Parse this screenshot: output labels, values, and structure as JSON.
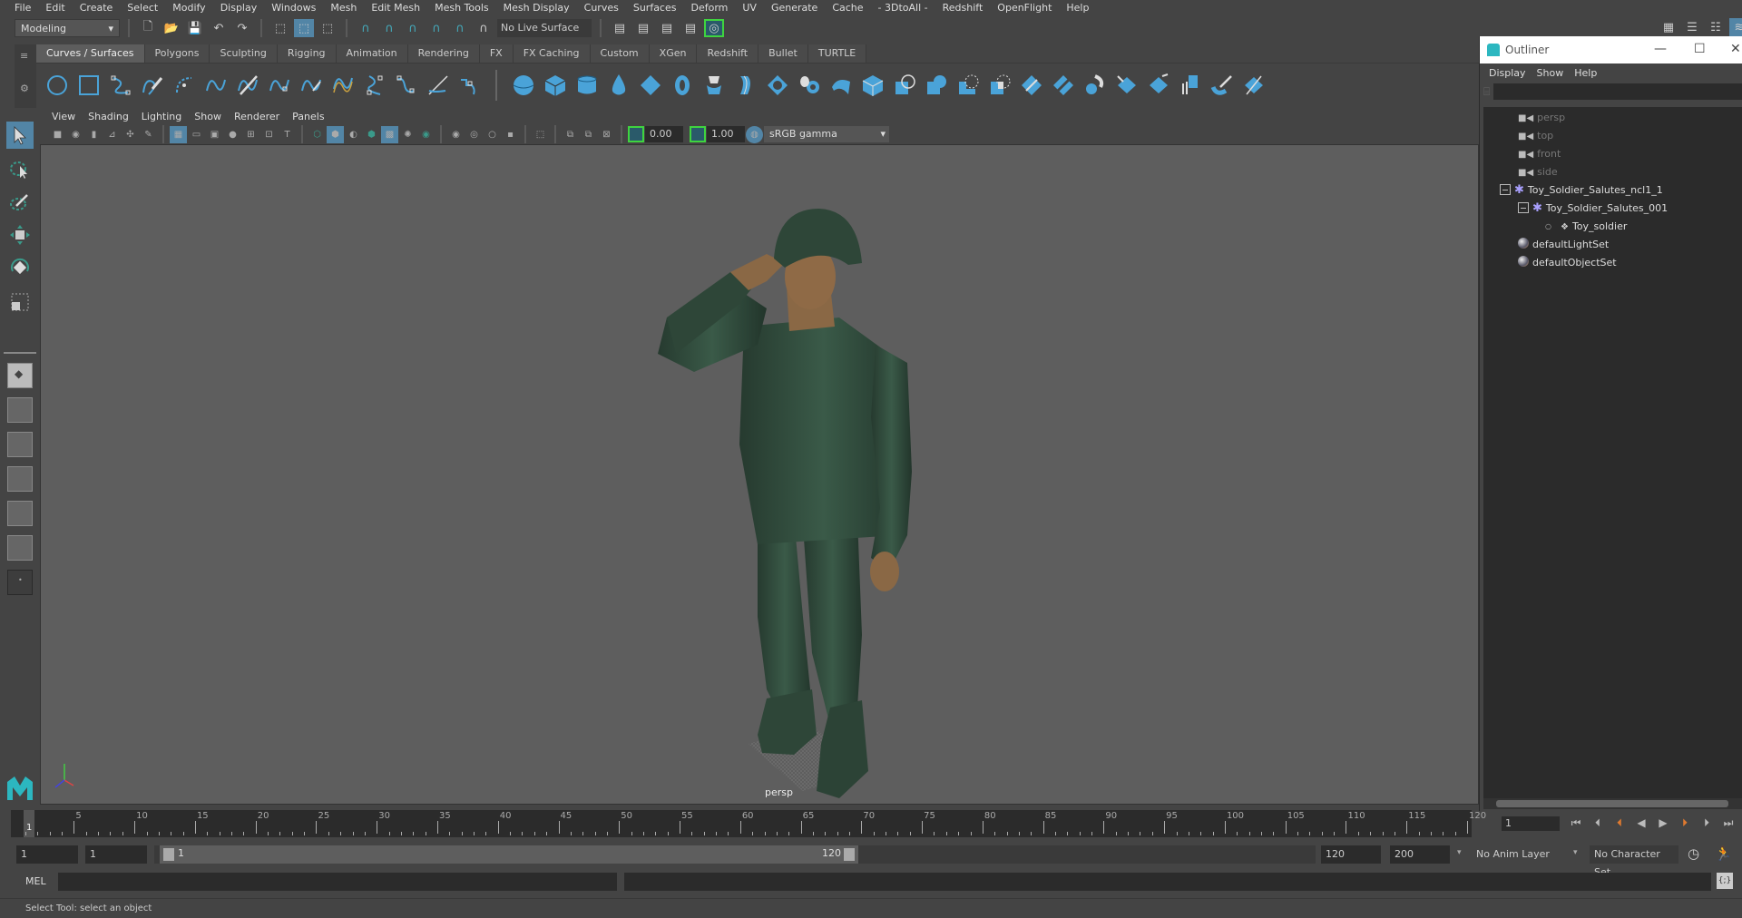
{
  "menubar": {
    "items": [
      "File",
      "Edit",
      "Create",
      "Select",
      "Modify",
      "Display",
      "Windows",
      "Mesh",
      "Edit Mesh",
      "Mesh Tools",
      "Mesh Display",
      "Curves",
      "Surfaces",
      "Deform",
      "UV",
      "Generate",
      "Cache",
      "- 3DtoAll -",
      "Redshift",
      "OpenFlight",
      "Help"
    ]
  },
  "statusline": {
    "mode": "Modeling",
    "live_surface": "No Live Surface"
  },
  "shelf": {
    "tabs": [
      "Curves / Surfaces",
      "Polygons",
      "Sculpting",
      "Rigging",
      "Animation",
      "Rendering",
      "FX",
      "FX Caching",
      "Custom",
      "XGen",
      "Redshift",
      "Bullet",
      "TURTLE"
    ],
    "active_tab": "Curves / Surfaces",
    "curve_icons": [
      "circle-curve-icon",
      "square-curve-icon",
      "cv-curve-icon",
      "pencil-curve-icon",
      "three-point-arc-icon",
      "ep-curve-icon",
      "cut-curve-icon",
      "curve-cv-icon",
      "extend-curve-icon",
      "offset-curve-icon",
      "rebuild-curve-icon",
      "insert-knot-icon",
      "bezier-icon",
      "attach-curve-icon"
    ],
    "surface_icons": [
      "nurbs-sphere-icon",
      "nurbs-cube-icon",
      "nurbs-cylinder-icon",
      "nurbs-cone-icon",
      "nurbs-plane-icon",
      "nurbs-torus-icon",
      "revolve-icon",
      "loft-icon",
      "planar-icon",
      "extrude-icon",
      "birail-icon",
      "bevel-plus-icon",
      "intersect-icon",
      "project-curve-icon",
      "trim-icon",
      "untrim-icon",
      "attach-surface-icon",
      "detach-surface-icon",
      "insert-isoparm-icon",
      "extend-surface-icon",
      "rebuild-surface-icon",
      "sculpt-icon",
      "stitch-icon",
      "surface-fillet-icon"
    ]
  },
  "panel": {
    "menus": [
      "View",
      "Shading",
      "Lighting",
      "Show",
      "Renderer",
      "Panels"
    ],
    "exposure": "0.00",
    "gamma": "1.00",
    "color_space": "sRGB gamma",
    "camera_label": "persp"
  },
  "outliner": {
    "title": "Outliner",
    "menus": [
      "Display",
      "Show",
      "Help"
    ],
    "items": [
      {
        "label": "persp",
        "icon": "camera-icon",
        "dim": true
      },
      {
        "label": "top",
        "icon": "camera-icon",
        "dim": true
      },
      {
        "label": "front",
        "icon": "camera-icon",
        "dim": true
      },
      {
        "label": "side",
        "icon": "camera-icon",
        "dim": true
      },
      {
        "label": "Toy_Soldier_Salutes_ncl1_1",
        "icon": "joint-icon",
        "expanded": true
      },
      {
        "label": "Toy_Soldier_Salutes_001",
        "icon": "joint-icon",
        "expanded": true
      },
      {
        "label": "Toy_soldier",
        "icon": "mesh-icon"
      },
      {
        "label": "defaultLightSet",
        "icon": "set-icon"
      },
      {
        "label": "defaultObjectSet",
        "icon": "set-icon"
      }
    ]
  },
  "timeline": {
    "ticks": [
      1,
      5,
      10,
      15,
      20,
      25,
      30,
      35,
      40,
      45,
      50,
      55,
      60,
      65,
      70,
      75,
      80,
      85,
      90,
      95,
      100,
      105,
      110,
      115,
      120
    ],
    "current_frame": "1",
    "start": 1,
    "end": 120
  },
  "range": {
    "anim_start": "1",
    "playback_start": "1",
    "range_start_label": "1",
    "range_end_label": "120",
    "playback_end": "120",
    "anim_end": "200",
    "anim_layer": "No Anim Layer",
    "character_set": "No Character Set"
  },
  "cmdline": {
    "label": "MEL"
  },
  "helpline": {
    "text": "Select Tool: select an object"
  },
  "colors": {
    "accent": "#5285a6",
    "shelf_icon": "#4aa3d8",
    "viewport_bg": "#5e5e5e",
    "soldier": "#2e4638"
  }
}
